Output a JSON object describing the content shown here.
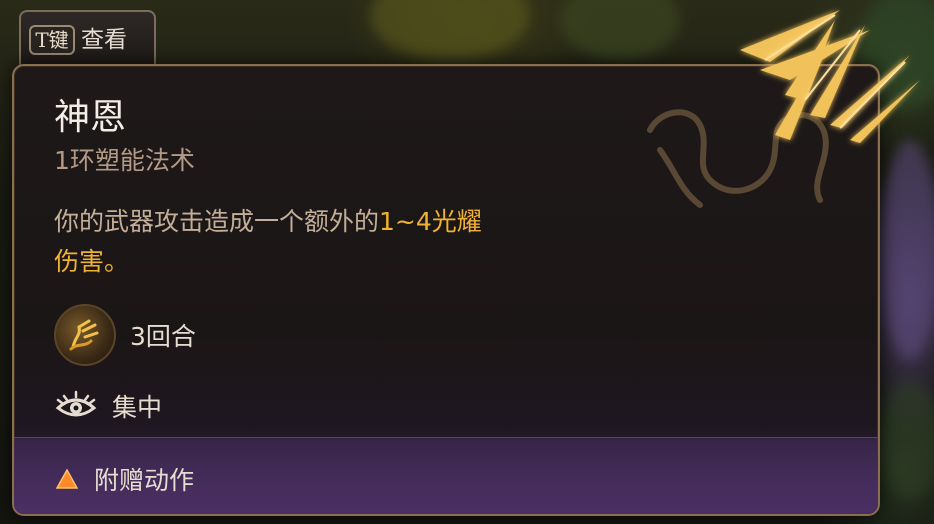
{
  "key_hint": {
    "key": "T键",
    "label": "查看"
  },
  "spell": {
    "name": "神恩",
    "level_school": "1环塑能法术",
    "description_prefix": "你的武器攻击造成一个额外的",
    "description_highlight": "1~4光耀",
    "description_suffix": "伤害。",
    "duration": "3回合",
    "concentration": "集中",
    "action_type": "附赠动作"
  },
  "icons": {
    "spell_icon": "divine-favor-spell-icon",
    "concentration_icon": "eye-icon",
    "action_icon": "bonus-action-triangle-icon"
  },
  "colors": {
    "highlight": "#f0b232",
    "subtitle": "#b29a86",
    "border": "#8a6e4e",
    "footer": "#4a2f63",
    "action_triangle": "#ff8a2a"
  }
}
